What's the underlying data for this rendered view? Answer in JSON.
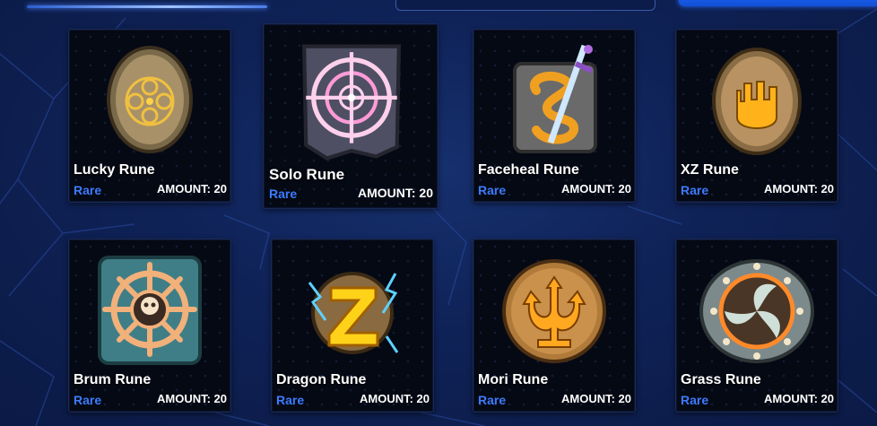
{
  "amount_prefix": "AMOUNT: ",
  "runes": [
    {
      "name": "Lucky Rune",
      "rarity": "Rare",
      "amount": "AMOUNT: 20",
      "icon": "lucky-rune-icon"
    },
    {
      "name": "Solo Rune",
      "rarity": "Rare",
      "amount": "AMOUNT: 20",
      "icon": "solo-rune-icon"
    },
    {
      "name": "Faceheal Rune",
      "rarity": "Rare",
      "amount": "AMOUNT: 20",
      "icon": "faceheal-rune-icon"
    },
    {
      "name": "XZ Rune",
      "rarity": "Rare",
      "amount": "AMOUNT: 20",
      "icon": "xz-rune-icon"
    },
    {
      "name": "Brum Rune",
      "rarity": "Rare",
      "amount": "AMOUNT: 20",
      "icon": "brum-rune-icon"
    },
    {
      "name": "Dragon Rune",
      "rarity": "Rare",
      "amount": "AMOUNT: 20",
      "icon": "dragon-rune-icon"
    },
    {
      "name": "Mori Rune",
      "rarity": "Rare",
      "amount": "AMOUNT: 20",
      "icon": "mori-rune-icon"
    },
    {
      "name": "Grass Rune",
      "rarity": "Rare",
      "amount": "AMOUNT: 20",
      "icon": "grass-rune-icon"
    }
  ],
  "colors": {
    "background": "#0f2257",
    "card": "#050914",
    "rarity": "#3d7bff",
    "accent": "#1f6bff"
  }
}
